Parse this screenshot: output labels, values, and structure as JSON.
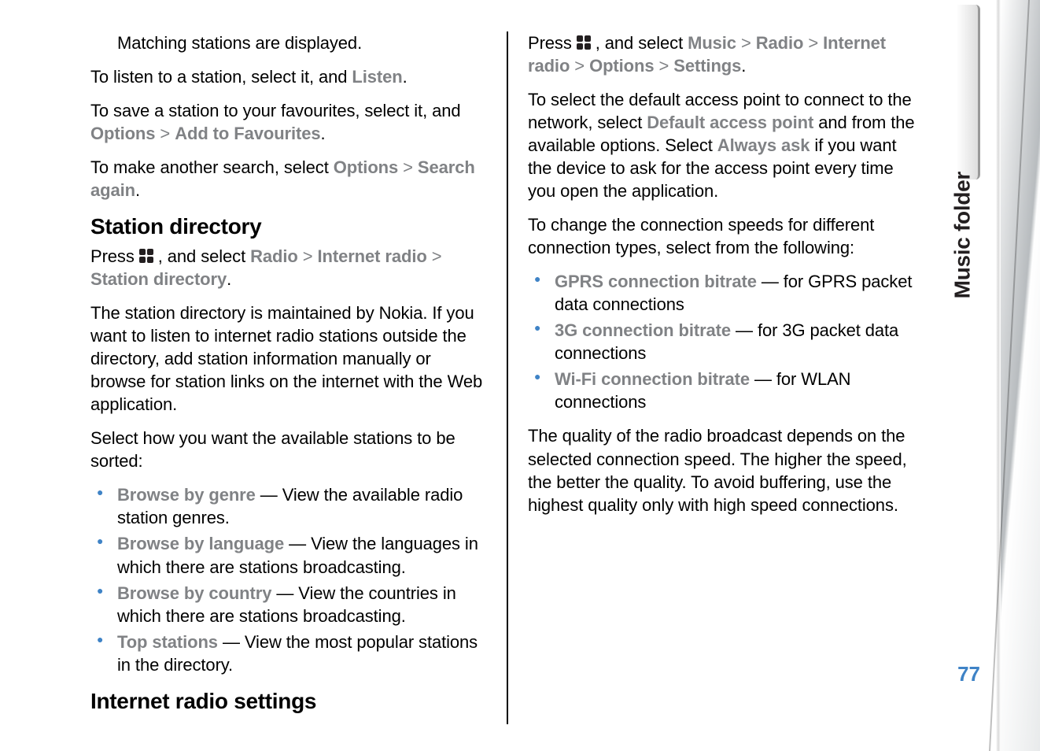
{
  "section_label": "Music folder",
  "page_number": "77",
  "left": {
    "matching": "Matching stations are displayed.",
    "listen_pre": "To listen to a station, select it, and ",
    "listen_bold": "Listen",
    "listen_post": ".",
    "save_pre": "To save a station to your favourites, select it, and ",
    "options_label": "Options",
    "gt": " > ",
    "add_fav": "Add to Favourites",
    "period": ".",
    "search_pre": "To make another search, select ",
    "search_again": "Search again",
    "h_station_dir": "Station directory",
    "press": "Press ",
    "and_select": " , and select ",
    "radio": "Radio",
    "internet_radio": "Internet radio",
    "station_dir": "Station directory",
    "dir_para": "The station directory is maintained by Nokia. If you want to listen to internet radio stations outside the directory, add station information manually or browse for station links on the internet with the Web application.",
    "sort_intro": "Select how you want the available stations to be sorted:",
    "items": [
      {
        "label": "Browse by genre",
        "desc": " —  View the available radio station genres."
      },
      {
        "label": "Browse by language",
        "desc": " —  View the languages in which there are stations broadcasting."
      },
      {
        "label": "Browse by country",
        "desc": " —  View the countries in which there are stations broadcasting."
      },
      {
        "label": "Top stations",
        "desc": " —  View the most popular stations in the directory."
      }
    ]
  },
  "right": {
    "h_settings": "Internet radio settings",
    "press": "Press ",
    "and_select": " , and select ",
    "music": "Music",
    "gt": " > ",
    "radio": "Radio",
    "internet_radio": "Internet radio",
    "options": "Options",
    "settings": "Settings",
    "period": ".",
    "ap_pre": "To select the default access point to connect to the network, select ",
    "default_ap": "Default access point",
    "ap_mid": " and from the available options. Select ",
    "always_ask": "Always ask",
    "ap_post": " if you want the device to ask for the access point every time you open the application.",
    "speeds_intro": "To change the connection speeds for different connection types, select from the following:",
    "items": [
      {
        "label": "GPRS connection bitrate",
        "desc": " —  for GPRS packet data connections"
      },
      {
        "label": "3G connection bitrate",
        "desc": " —  for 3G packet data connections"
      },
      {
        "label": "Wi-Fi connection bitrate",
        "desc": " —  for WLAN connections"
      }
    ],
    "quality": "The quality of the radio broadcast depends on the selected connection speed. The higher the speed, the better the quality. To avoid buffering, use the highest quality only with high speed connections."
  }
}
